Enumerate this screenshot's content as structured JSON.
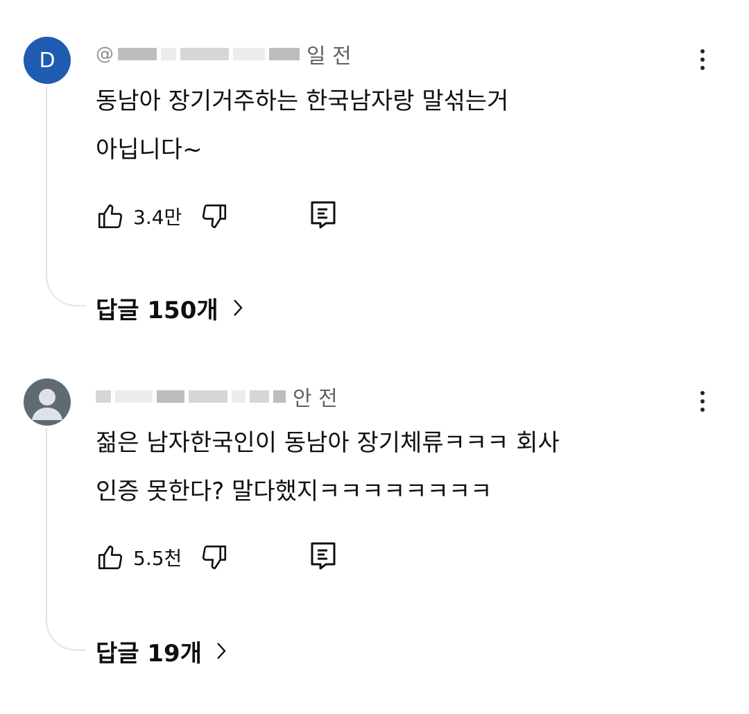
{
  "comments": [
    {
      "avatar_letter": "D",
      "avatar_color": "#1f5bb0",
      "author_prefix": "@",
      "time": "일 전",
      "lines": [
        "동남아 장기거주하는 한국남자랑 말섞는거",
        "아닙니다~"
      ],
      "likes": "3.4만",
      "replies_label": "답글 150개"
    },
    {
      "avatar_letter": "",
      "avatar_color": "#5f6b72",
      "author_prefix": "",
      "time": "안 전",
      "lines": [
        "젊은 남자한국인이 동남아 장기체류ㅋㅋㅋ 회사",
        "인증 못한다? 말다했지ㅋㅋㅋㅋㅋㅋㅋㅋ"
      ],
      "likes": "5.5천",
      "replies_label": "답글 19개"
    }
  ],
  "icons": {
    "more": "more-vert-icon",
    "like": "thumb-up-icon",
    "dislike": "thumb-down-icon",
    "reply": "comment-reply-icon",
    "chevron": "chevron-right-icon"
  }
}
